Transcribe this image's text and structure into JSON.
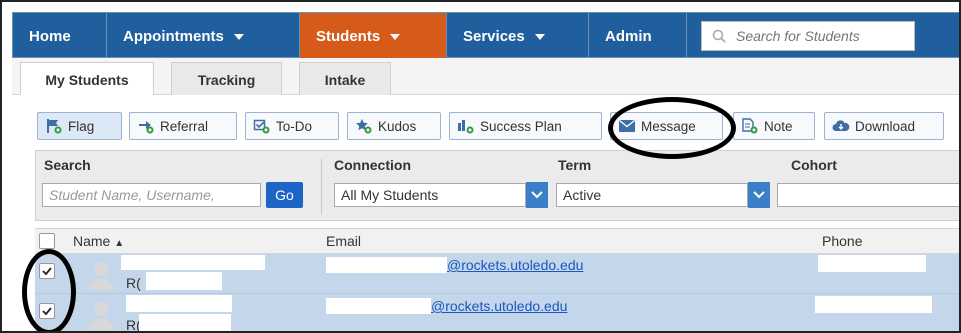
{
  "nav": {
    "home": "Home",
    "appointments": "Appointments",
    "students": "Students",
    "services": "Services",
    "admin": "Admin",
    "search_placeholder": "Search for Students"
  },
  "tabs": [
    "My Students",
    "Tracking",
    "Intake"
  ],
  "toolbar": {
    "flag": "Flag",
    "referral": "Referral",
    "todo": "To-Do",
    "kudos": "Kudos",
    "success_plan": "Success Plan",
    "message": "Message",
    "note": "Note",
    "download": "Download"
  },
  "filters": {
    "search_label": "Search",
    "search_placeholder": "Student Name, Username, ",
    "go": "Go",
    "connection_label": "Connection",
    "connection_value": "All My Students",
    "term_label": "Term",
    "term_value": "Active",
    "cohort_label": "Cohort",
    "cohort_value": ""
  },
  "table": {
    "col_name": "Name",
    "col_email": "Email",
    "col_phone": "Phone",
    "rows": [
      {
        "id": "R(",
        "email": "@rockets.utoledo.edu"
      },
      {
        "id": "R(",
        "email": "@rockets.utoledo.edu"
      }
    ]
  },
  "colors": {
    "nav_bg": "#1f5f9e",
    "active_nav": "#d65a1a",
    "row_selected": "#c4d7ea",
    "link": "#1a56c0"
  }
}
